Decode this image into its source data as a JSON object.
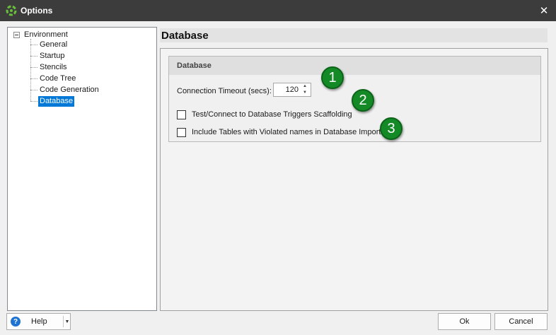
{
  "window": {
    "title": "Options",
    "close_symbol": "✕"
  },
  "tree": {
    "root_label": "Environment",
    "items": [
      {
        "label": "General"
      },
      {
        "label": "Startup"
      },
      {
        "label": "Stencils"
      },
      {
        "label": "Code Tree"
      },
      {
        "label": "Code Generation"
      },
      {
        "label": "Database",
        "selected": true
      }
    ]
  },
  "page": {
    "title": "Database",
    "group_title": "Database",
    "connection_timeout": {
      "label": "Connection Timeout (secs):",
      "value": "120",
      "up_symbol": "▲",
      "down_symbol": "▼"
    },
    "checkboxes": [
      {
        "label": "Test/Connect to Database Triggers Scaffolding",
        "checked": false
      },
      {
        "label": "Include Tables with Violated names in Database Import",
        "checked": false
      }
    ]
  },
  "annotations": [
    "1",
    "2",
    "3"
  ],
  "footer": {
    "help_icon": "?",
    "help_label": "Help",
    "help_arrow": "▼",
    "ok_label": "Ok",
    "cancel_label": "Cancel"
  },
  "colors": {
    "titlebar": "#3c3c3c",
    "selection": "#0078d7",
    "badge_green": "#148a27",
    "app_icon_green": "#6abf3c"
  },
  "icons": {
    "app": "app-logo-icon",
    "close": "close-icon",
    "help": "help-icon",
    "dropdown": "chevron-down-icon"
  }
}
